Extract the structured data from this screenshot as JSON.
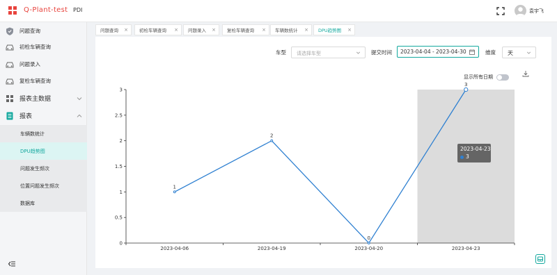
{
  "header": {
    "brand": "Q-Plant-test",
    "app": "PDI",
    "user_name": "袁宇飞"
  },
  "sidebar": {
    "items": [
      {
        "label": "问题查询",
        "icon": "shield-icon"
      },
      {
        "label": "初检车辆查询",
        "icon": "car-icon"
      },
      {
        "label": "问题录入",
        "icon": "car-icon"
      },
      {
        "label": "复检车辆查询",
        "icon": "car-icon"
      },
      {
        "label": "报表主数据",
        "icon": "grid-icon"
      },
      {
        "label": "报表",
        "icon": "report-icon"
      }
    ],
    "subitems": [
      {
        "label": "车辆数统计"
      },
      {
        "label": "DPU趋势图"
      },
      {
        "label": "问题发生频次"
      },
      {
        "label": "位置问题发生频次"
      },
      {
        "label": "数据库"
      }
    ]
  },
  "tabs": [
    {
      "label": "问题查询"
    },
    {
      "label": "初检车辆查询"
    },
    {
      "label": "问题录入"
    },
    {
      "label": "复检车辆查询"
    },
    {
      "label": "车辆数统计"
    },
    {
      "label": "DPU趋势图"
    }
  ],
  "filters": {
    "car_type_label": "车型",
    "car_type_placeholder": "请选择车型",
    "submit_time_label": "提交时间",
    "date_range": "2023-04-04 - 2023-04-30",
    "dimension_label": "维度",
    "dimension_value": "天",
    "show_all_dates_label": "显示所有日期"
  },
  "tooltip": {
    "date": "2023-04-23",
    "value": "3"
  },
  "colors": {
    "accent": "#13a89e",
    "line": "#2f80d1",
    "brand": "#e8433d"
  },
  "chart_data": {
    "type": "line",
    "categories": [
      "2023-04-06",
      "2023-04-19",
      "2023-04-20",
      "2023-04-23"
    ],
    "series": [
      {
        "values": [
          1,
          2,
          0,
          3
        ]
      }
    ],
    "data_labels": [
      "1",
      "2",
      "0",
      "3"
    ],
    "y_ticks": [
      "0",
      "0.5",
      "1",
      "1.5",
      "2",
      "2.5",
      "3"
    ],
    "ylim": [
      0,
      3
    ],
    "highlighted_category": "2023-04-23",
    "grid": false
  }
}
